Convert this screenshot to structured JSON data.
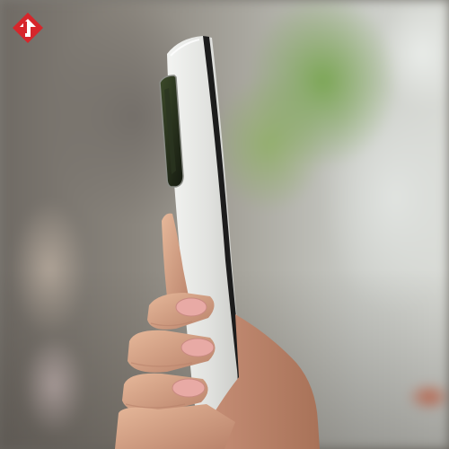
{
  "image": {
    "icons": [
      "brand-logo-icon"
    ],
    "colors": {
      "logo_red": "#d6262b",
      "phone_body": "#e2e3e1",
      "phone_frame": "#1a1a1a",
      "camera_module": "#2c3a20",
      "skin": "#d9a98a",
      "foliage": "#7fa55a"
    }
  }
}
